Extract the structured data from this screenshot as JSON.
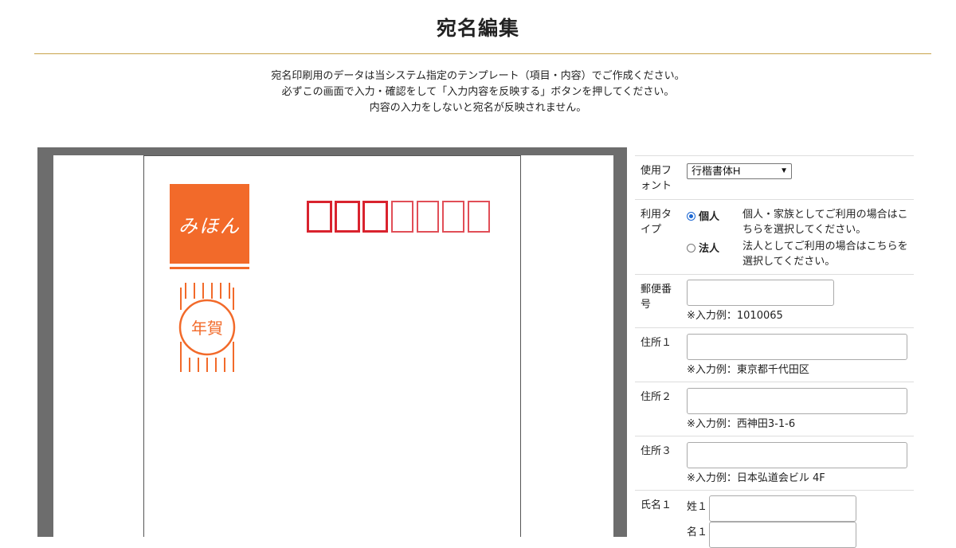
{
  "page": {
    "title": "宛名編集",
    "instructions": [
      "宛名印刷用のデータは当システム指定のテンプレート（項目・内容）でご作成ください。",
      "必ずこの画面で入力・確認をして「入力内容を反映する」ボタンを押してください。",
      "内容の入力をしないと宛名が反映されません。"
    ]
  },
  "preview": {
    "brand_text": "みほん",
    "stamp_text": "年賀",
    "colors": {
      "brand": "#f26a2a",
      "postal_box": "#d9232e",
      "frame": "#6d6d6d"
    },
    "postal_box_count": 7
  },
  "form": {
    "font": {
      "label": "使用フォント",
      "value": "行楷書体H"
    },
    "usage_type": {
      "label": "利用タイプ",
      "options": [
        {
          "label": "個人",
          "checked": true,
          "description": "個人・家族としてご利用の場合はこちらを選択してください。"
        },
        {
          "label": "法人",
          "checked": false,
          "description": "法人としてご利用の場合はこちらを選択してください。"
        }
      ]
    },
    "postal_code": {
      "label": "郵便番号",
      "value": "",
      "example": "※入力例：1010065"
    },
    "address1": {
      "label": "住所１",
      "value": "",
      "example": "※入力例：東京都千代田区"
    },
    "address2": {
      "label": "住所２",
      "value": "",
      "example": "※入力例：西神田3-1-6"
    },
    "address3": {
      "label": "住所３",
      "value": "",
      "example": "※入力例：日本弘道会ビル 4F"
    },
    "name1": {
      "label": "氏名１",
      "last_label": "姓１",
      "first_label": "名１",
      "last_value": "",
      "first_value": ""
    }
  }
}
